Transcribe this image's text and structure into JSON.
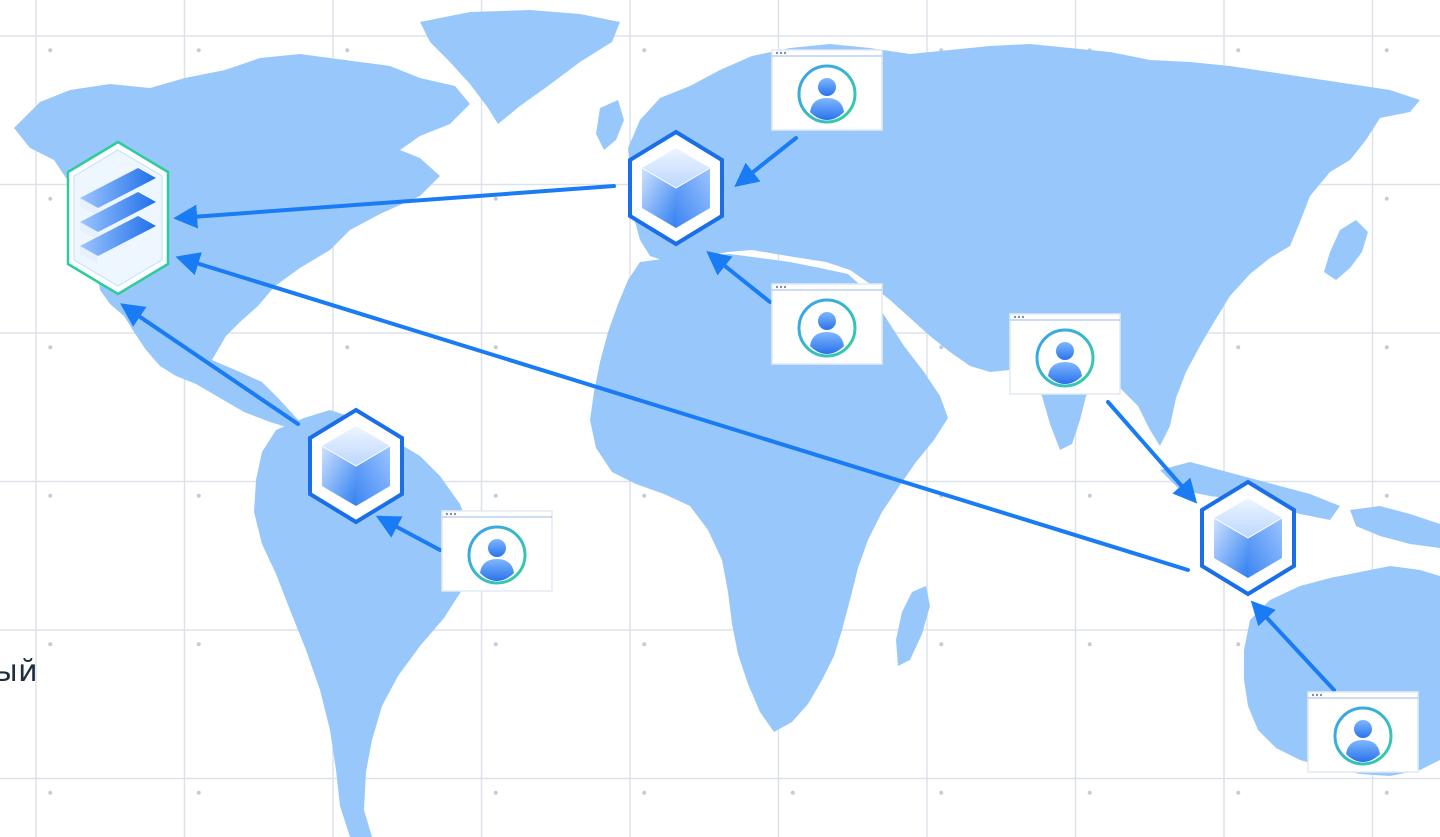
{
  "caption_fragment": "ый",
  "colors": {
    "background": "#ffffff",
    "grid": "#d8dde6",
    "grid_dot": "#c6ccd6",
    "continent": "#98c8fb",
    "arrow": "#1a7cf5",
    "node_dark": "#1a6fe8",
    "node_light": "#dbeaff",
    "origin_border": "#2ecc9a",
    "avatar_ring_a": "#3aa0f0",
    "avatar_ring_b": "#35d0a0",
    "avatar_figure": "#3a8af2"
  },
  "icons": {
    "origin_server": "server-stack-icon",
    "edge_node": "cube-node-icon",
    "client": "user-browser-window-icon"
  },
  "diagram": {
    "origin": "origin-server",
    "edge_nodes": [
      "edge-europe",
      "edge-south-america",
      "edge-southeast-asia"
    ],
    "clients": [
      "client-north-europe",
      "client-africa",
      "client-brazil",
      "client-india",
      "client-australia"
    ],
    "flows": [
      {
        "from": "client-north-europe",
        "to": "edge-europe"
      },
      {
        "from": "client-africa",
        "to": "edge-europe"
      },
      {
        "from": "client-brazil",
        "to": "edge-south-america"
      },
      {
        "from": "client-india",
        "to": "edge-southeast-asia"
      },
      {
        "from": "client-australia",
        "to": "edge-southeast-asia"
      },
      {
        "from": "edge-europe",
        "to": "origin-server"
      },
      {
        "from": "edge-south-america",
        "to": "origin-server"
      },
      {
        "from": "edge-southeast-asia",
        "to": "origin-server"
      }
    ]
  }
}
